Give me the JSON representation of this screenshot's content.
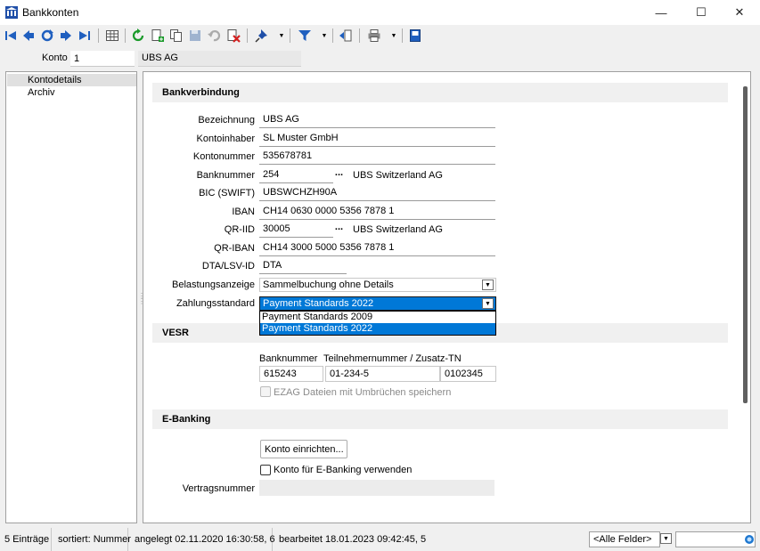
{
  "window": {
    "title": "Bankkonten",
    "minimize_glyph": "—",
    "maximize_glyph": "☐",
    "close_glyph": "✕"
  },
  "toolbar": {
    "icons": [
      "first-record-icon",
      "previous-record-icon",
      "refresh-record-icon",
      "next-record-icon",
      "last-record-icon",
      "table-view-icon",
      "reload-icon",
      "new-record-icon",
      "copy-record-icon",
      "save-record-icon",
      "undo-icon",
      "delete-record-icon",
      "pin-icon",
      "filter-icon",
      "import-icon",
      "print-icon",
      "export-icon"
    ]
  },
  "key": {
    "label": "Konto",
    "value": "1",
    "description": "UBS AG"
  },
  "nav": {
    "items": [
      "Kontodetails",
      "Archiv"
    ],
    "selected": "Kontodetails"
  },
  "sections": {
    "bank": "Bankverbindung",
    "vesr": "VESR",
    "ebanking": "E-Banking"
  },
  "form": {
    "bezeichnung": {
      "label": "Bezeichnung",
      "value": "UBS AG"
    },
    "kontoinhaber": {
      "label": "Kontoinhaber",
      "value": "SL Muster GmbH"
    },
    "kontonummer": {
      "label": "Kontonummer",
      "value": "535678781"
    },
    "banknummer": {
      "label": "Banknummer",
      "value": "254",
      "bank_name": "UBS Switzerland AG"
    },
    "bic": {
      "label": "BIC (SWIFT)",
      "value": "UBSWCHZH90A"
    },
    "iban": {
      "label": "IBAN",
      "value": "CH14 0630 0000 5356 7878 1"
    },
    "qr_iid": {
      "label": "QR-IID",
      "value": "30005",
      "bank_name": "UBS Switzerland AG"
    },
    "qr_iban": {
      "label": "QR-IBAN",
      "value": "CH14 3000 5000 5356 7878 1"
    },
    "dta_lsv": {
      "label": "DTA/LSV-ID",
      "value": "DTA"
    },
    "belastung": {
      "label": "Belastungsanzeige",
      "value": "Sammelbuchung ohne Details"
    },
    "zahlungsstandard": {
      "label": "Zahlungsstandard",
      "value": "Payment Standards 2022",
      "options": [
        "Payment Standards 2009",
        "Payment Standards 2022"
      ]
    },
    "ellipsis": "..."
  },
  "vesr": {
    "col_bank": "Banknummer",
    "col_teilnehmer": "Teilnehmernummer / Zusatz-TN",
    "banknummer": "615243",
    "teilnehmer": "01-234-5",
    "zusatz": "0102345",
    "ezag_label": "EZAG Dateien mit Umbrüchen speichern",
    "ezag_checked": false
  },
  "ebanking": {
    "setup_button": "Konto einrichten...",
    "use_label": "Konto für E-Banking verwenden",
    "use_checked": false,
    "vertrag_label": "Vertragsnummer",
    "vertrag_value": ""
  },
  "status": {
    "count": "5 Einträge",
    "sorted": "sortiert: Nummer",
    "created": "angelegt 02.11.2020 16:30:58,  6",
    "edited": "bearbeitet 18.01.2023 09:42:45,  5",
    "field_filter": "<Alle Felder>",
    "search_value": ""
  }
}
